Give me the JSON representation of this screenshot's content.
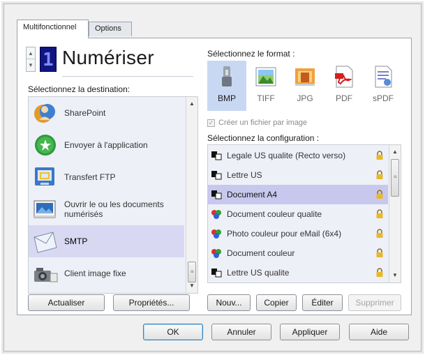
{
  "tabs": [
    "Multifonctionnel",
    "Options"
  ],
  "profile": {
    "number": "1",
    "title": "Numériser"
  },
  "destination": {
    "label": "Sélectionnez la destination:",
    "items": [
      {
        "label": "SharePoint",
        "icon": "sharepoint-icon",
        "selected": false
      },
      {
        "label": "Envoyer à l'application",
        "icon": "send-to-app-icon",
        "selected": false
      },
      {
        "label": "Transfert FTP",
        "icon": "ftp-icon",
        "selected": false
      },
      {
        "label": "Ouvrir le ou les documents numérisés",
        "icon": "open-documents-icon",
        "selected": false
      },
      {
        "label": "SMTP",
        "icon": "email-icon",
        "selected": true
      },
      {
        "label": "Client image fixe",
        "icon": "still-image-client-icon",
        "selected": false
      }
    ]
  },
  "format": {
    "label": "Sélectionnez le format :",
    "items": [
      {
        "label": "BMP",
        "selected": true
      },
      {
        "label": "TIFF",
        "selected": false
      },
      {
        "label": "JPG",
        "selected": false
      },
      {
        "label": "PDF",
        "selected": false
      },
      {
        "label": "sPDF",
        "selected": false
      }
    ],
    "one_file_per_image": {
      "label": "Créer un fichier par image",
      "checked": true,
      "enabled": false
    }
  },
  "configuration": {
    "label": "Sélectionnez la configuration :",
    "items": [
      {
        "label": "Legale US qualite (Recto verso)",
        "type": "bw",
        "selected": false
      },
      {
        "label": "Lettre US",
        "type": "bw",
        "selected": false
      },
      {
        "label": "Document A4",
        "type": "bw",
        "selected": true
      },
      {
        "label": "Document couleur qualite",
        "type": "color",
        "selected": false
      },
      {
        "label": "Photo couleur pour eMail (6x4)",
        "type": "color",
        "selected": false
      },
      {
        "label": "Document couleur",
        "type": "color",
        "selected": false
      },
      {
        "label": "Lettre US qualite",
        "type": "bw",
        "selected": false
      }
    ]
  },
  "buttons": {
    "refresh": "Actualiser",
    "properties": "Propriétés...",
    "new": "Nouv...",
    "copy": "Copier",
    "edit": "Éditer",
    "delete": "Supprimer"
  },
  "dialog_buttons": {
    "ok": "OK",
    "cancel": "Annuler",
    "apply": "Appliquer",
    "help": "Aide"
  },
  "colors": {
    "selection": "#d8d8f2",
    "lcd_background": "#111580",
    "lcd_digit": "#7d8dff",
    "bmp_selected": "#c9d8f2"
  }
}
